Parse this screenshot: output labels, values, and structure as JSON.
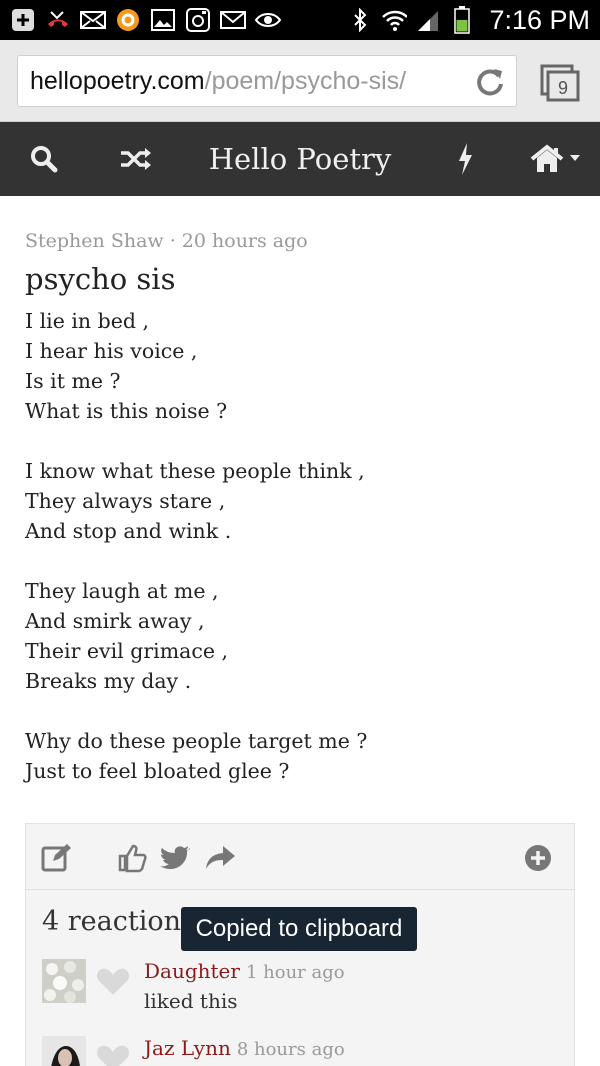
{
  "status_bar": {
    "time": "7:16 PM",
    "icons": [
      "plus-icon",
      "missed-call-icon",
      "mail-icon",
      "app-icon",
      "picture-icon",
      "instagram-icon",
      "gmail-icon",
      "eye-icon",
      "bluetooth-icon",
      "wifi-icon",
      "signal-icon",
      "battery-icon"
    ]
  },
  "browser": {
    "url_host": "hellopoetry.com",
    "url_path": "/poem/psycho-sis/",
    "tab_count": "9"
  },
  "nav": {
    "title": "Hello Poetry"
  },
  "post": {
    "author": "Stephen Shaw",
    "separator": " · ",
    "time": "20 hours ago",
    "title": "psycho sis",
    "stanzas": [
      [
        "I lie in bed ,",
        "I hear his voice ,",
        "Is it me ?",
        "What is this noise ?"
      ],
      [
        "I know what these people think ,",
        "They always stare ,",
        "And stop and wink ."
      ],
      [
        "They laugh at me ,",
        "And smirk away ,",
        "Their evil grimace ,",
        "Breaks my day ."
      ],
      [
        "Why do these people target me ?",
        "Just to feel bloated glee ?"
      ]
    ]
  },
  "reactions": {
    "title": "4 reactions",
    "toast": "Copied to clipboard",
    "items": [
      {
        "name": "Daughter",
        "time": "1 hour ago",
        "text": "liked this"
      },
      {
        "name": "Jaz Lynn",
        "time": "8 hours ago",
        "text": ""
      }
    ]
  },
  "colors": {
    "nav_bg": "#333333",
    "author_link": "#8b1a1a",
    "toast_bg": "#182633"
  }
}
